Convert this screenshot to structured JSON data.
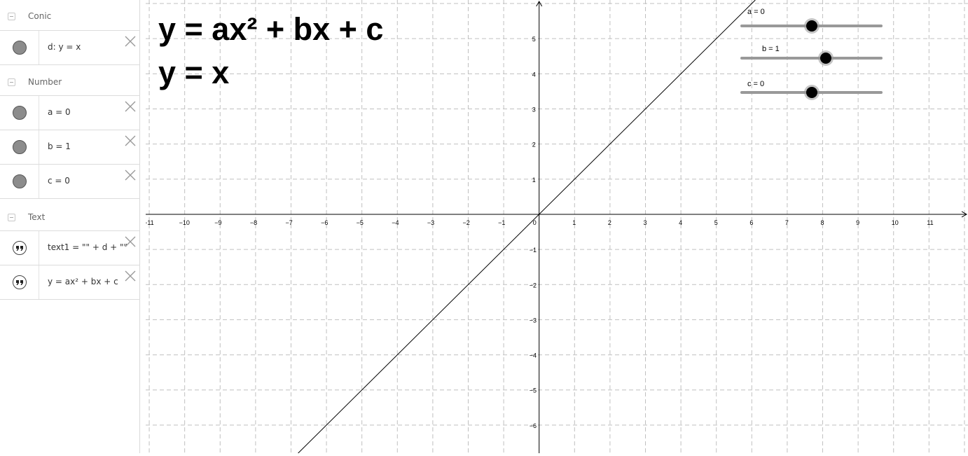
{
  "algebra": {
    "groups": [
      {
        "label": "Conic",
        "items": [
          {
            "text": "d: y = x",
            "type": "dot"
          }
        ]
      },
      {
        "label": "Number",
        "items": [
          {
            "text": "a = 0",
            "type": "dot"
          },
          {
            "text": "b = 1",
            "type": "dot"
          },
          {
            "text": "c = 0",
            "type": "dot"
          }
        ]
      },
      {
        "label": "Text",
        "items": [
          {
            "text": "text1 = \"\" + d + \"\"",
            "type": "quote"
          },
          {
            "text": "y = ax² + bx + c",
            "type": "quote"
          }
        ]
      }
    ]
  },
  "graphics": {
    "title_text": "y = ax² + bx + c",
    "equation_text": "y = x",
    "sliders": [
      {
        "label": "a = 0",
        "value": 0,
        "min": -5,
        "max": 5
      },
      {
        "label": "b = 1",
        "value": 1,
        "min": -5,
        "max": 5
      },
      {
        "label": "c = 0",
        "value": 0,
        "min": -5,
        "max": 5
      }
    ]
  },
  "chart_data": {
    "type": "line",
    "title": "",
    "xlim": [
      -11.1,
      12.1
    ],
    "ylim": [
      -6.8,
      6.1
    ],
    "grid": true,
    "x_ticks": [
      "-11",
      "-10",
      "-9",
      "-8",
      "-7",
      "-6",
      "-5",
      "-4",
      "-3",
      "-2",
      "-1",
      "0",
      "1",
      "2",
      "3",
      "4",
      "5",
      "6",
      "7",
      "8",
      "9",
      "10",
      "11"
    ],
    "y_ticks": [
      "-6",
      "-5",
      "-4",
      "-3",
      "-2",
      "-1",
      "1",
      "2",
      "3",
      "4",
      "5"
    ],
    "series": [
      {
        "values": [
          [
            -6.8,
            -6.8
          ],
          [
            6.1,
            6.1
          ]
        ]
      }
    ]
  }
}
